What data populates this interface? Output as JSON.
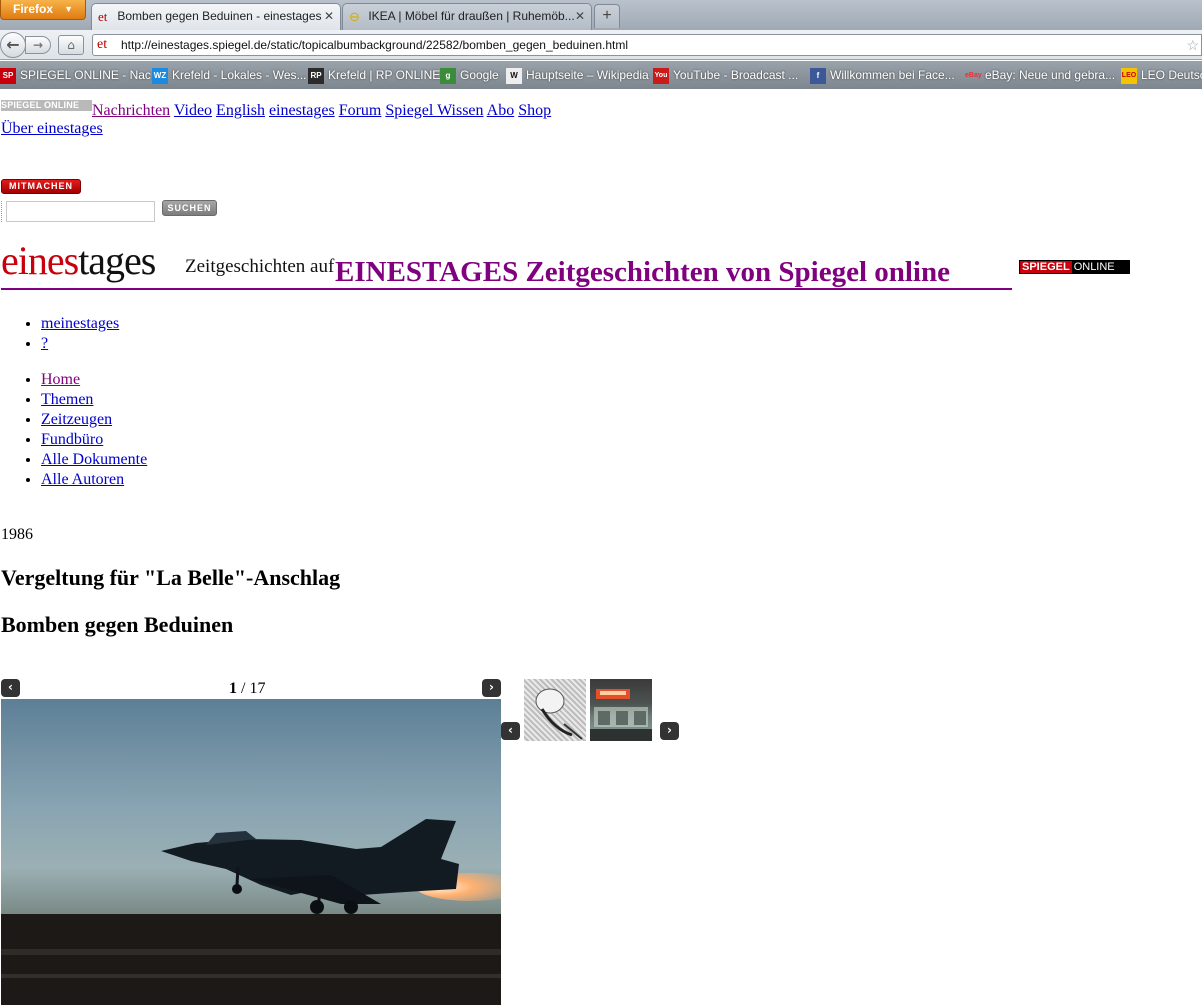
{
  "browser": {
    "menu_label": "Firefox",
    "tabs": [
      {
        "title": "Bomben gegen Beduinen - einestages",
        "favicon": "et"
      },
      {
        "title": "IKEA | Möbel für draußen | Ruhemöb...",
        "favicon": "ikea"
      }
    ],
    "new_tab": "+",
    "url": "http://einestages.spiegel.de/static/topicalbumbackground/22582/bomben_gegen_beduinen.html",
    "url_favicon": "et",
    "bookmarks": [
      {
        "label": "SPIEGEL ONLINE - Nac...",
        "icon": "spon",
        "icon_text": "SP"
      },
      {
        "label": "Krefeld - Lokales - Wes...",
        "icon": "wz",
        "icon_text": "WZ"
      },
      {
        "label": "Krefeld | RP ONLINE",
        "icon": "rp",
        "icon_text": "RP"
      },
      {
        "label": "Google",
        "icon": "google",
        "icon_text": "g"
      },
      {
        "label": "Hauptseite – Wikipedia",
        "icon": "wikipedia",
        "icon_text": "W"
      },
      {
        "label": "YouTube - Broadcast ...",
        "icon": "youtube",
        "icon_text": "You"
      },
      {
        "label": "Willkommen bei Face...",
        "icon": "facebook",
        "icon_text": "f"
      },
      {
        "label": "eBay: Neue und gebra...",
        "icon": "ebay",
        "icon_text": "eBay"
      },
      {
        "label": "LEO Deutsch",
        "icon": "leo",
        "icon_text": "LEO"
      }
    ]
  },
  "top_nav": {
    "logo": "SPIEGEL ONLINE",
    "links": [
      "Nachrichten",
      "Video",
      "English",
      "einestages",
      "Forum",
      "Spiegel Wissen",
      "Abo",
      "Shop"
    ],
    "about": "Über einestages"
  },
  "mitmachen": "MITMACHEN",
  "search": {
    "value": "",
    "button": "SUCHEN"
  },
  "brand": {
    "logo_red": "eines",
    "logo_black": "tages",
    "sub": "Zeitgeschichten auf",
    "headline": "EINESTAGES Zeitgeschichten von Spiegel online",
    "spon_red": "SPIEGEL",
    "spon_white": "ONLINE"
  },
  "user_links": [
    "meinestages",
    "?"
  ],
  "main_nav": [
    "Home",
    "Themen",
    "Zeitzeugen",
    "Fundbüro",
    "Alle Dokumente",
    "Alle Autoren"
  ],
  "article": {
    "year": "1986",
    "kicker": "Vergeltung für \"La Belle\"-Anschlag",
    "title": "Bomben gegen Beduinen"
  },
  "gallery": {
    "current": "1",
    "separator": "/",
    "total": "17",
    "prev_icon": "chevron-left-icon",
    "next_icon": "chevron-right-icon"
  }
}
